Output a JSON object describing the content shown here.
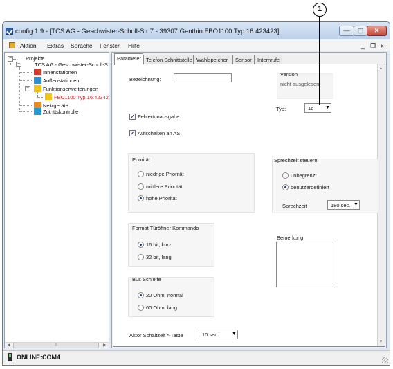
{
  "callout": {
    "number": "1"
  },
  "window": {
    "title": "config 1.9 - [TCS AG - Geschwister-Scholl-Str 7 - 39307 Genthin:FBO1100 Typ 16:423423]"
  },
  "menu": {
    "items": [
      "Aktion",
      "Extras",
      "Sprache",
      "Fenster",
      "Hilfe"
    ],
    "mdi_controls": [
      "_",
      "❐",
      "x"
    ]
  },
  "tree": {
    "root": "Projekte",
    "project": "TCS AG - Geschwister-Scholl-S",
    "nodes": [
      {
        "label": "Innenstationen",
        "color": "#d83b2d"
      },
      {
        "label": "Außenstationen",
        "color": "#2a8fd6"
      },
      {
        "label": "Funktionserweiterungen",
        "color": "#f2c31b"
      },
      {
        "label": "FBO1100 Typ 16:42342",
        "color": "#f2c31b",
        "selected_color": "#d21f1f"
      },
      {
        "label": "Netzgeräte",
        "color": "#f08a1c"
      },
      {
        "label": "Zutrittskontrolle",
        "color": "#1f9ad4"
      }
    ],
    "scroll_thumb_text": "III"
  },
  "tabs": [
    "Parameter",
    "Telefon Schnittstelle",
    "Wahlspeicher",
    "Sensor",
    "Internrufe"
  ],
  "form": {
    "bezeichnung_label": "Bezeichnung:",
    "bezeichnung_value": "",
    "version_label": "Version",
    "version_value": "nicht ausgelesen",
    "typ_label": "Typ:",
    "typ_value": "16",
    "fehlertonausgabe_label": "Fehlertonausgabe",
    "aufschalten_label": "Aufschalten an AS",
    "prioritaet": {
      "title": "Priorität",
      "options": [
        "niedrige Priorität",
        "mittlere Priorität",
        "hohe Priorität"
      ],
      "selected": "hohe Priorität"
    },
    "sprechzeit_steuern": {
      "title": "Sprechzeit steuern",
      "options": [
        "unbegrenzt",
        "benutzerdefiniert"
      ],
      "selected": "benutzerdefiniert",
      "sprechzeit_label": "Sprechzeit",
      "sprechzeit_value": "180 sec."
    },
    "format": {
      "title": "Format Türöffner Kommando",
      "options": [
        "16 bit, kurz",
        "32 bit, lang"
      ],
      "selected": "16 bit, kurz"
    },
    "bemerkung_label": "Bemerkung:",
    "bemerkung_value": "",
    "bus_schleife": {
      "title": "Bus Schleife",
      "options": [
        "20 Ohm, normal",
        "60 Ohm, lang"
      ],
      "selected": "20 Ohm, normal"
    },
    "aktor_label": "Aktor Schaltzeit *-Taste",
    "aktor_value": "10 sec."
  },
  "status": {
    "text": "ONLINE:COM4"
  }
}
